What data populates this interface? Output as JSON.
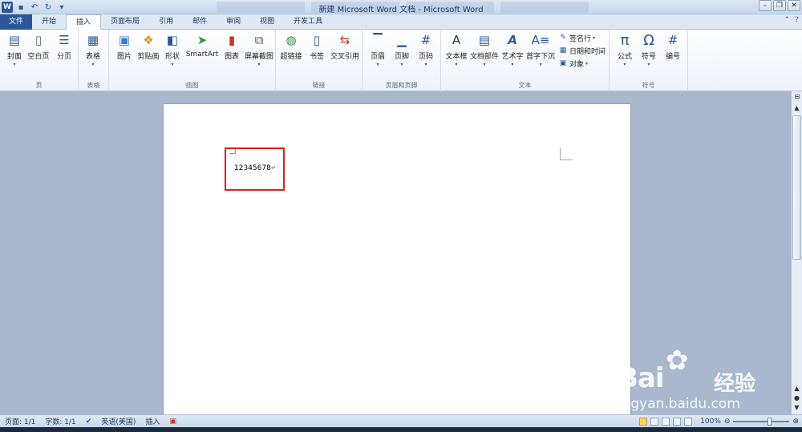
{
  "window": {
    "title": "新建 Microsoft Word 文档 - Microsoft Word",
    "app_logo": "W"
  },
  "tabs": [
    {
      "label": "文件",
      "type": "file"
    },
    {
      "label": "开始"
    },
    {
      "label": "插入",
      "active": true
    },
    {
      "label": "页面布局"
    },
    {
      "label": "引用"
    },
    {
      "label": "邮件"
    },
    {
      "label": "审阅"
    },
    {
      "label": "视图"
    },
    {
      "label": "开发工具"
    }
  ],
  "ribbon": {
    "groups": {
      "pages": {
        "label": "页",
        "buttons": [
          {
            "label": "封面",
            "icon": "cover-page-icon"
          },
          {
            "label": "空白页",
            "icon": "blank-page-icon"
          },
          {
            "label": "分页",
            "icon": "page-break-icon"
          }
        ]
      },
      "tables": {
        "label": "表格",
        "buttons": [
          {
            "label": "表格",
            "icon": "table-icon"
          }
        ]
      },
      "illustrations": {
        "label": "插图",
        "buttons": [
          {
            "label": "图片",
            "icon": "picture-icon"
          },
          {
            "label": "剪贴画",
            "icon": "clipart-icon"
          },
          {
            "label": "形状",
            "icon": "shapes-icon"
          },
          {
            "label": "SmartArt",
            "icon": "smartart-icon"
          },
          {
            "label": "图表",
            "icon": "chart-icon"
          },
          {
            "label": "屏幕截图",
            "icon": "screenshot-icon"
          }
        ]
      },
      "links": {
        "label": "链接",
        "buttons": [
          {
            "label": "超链接",
            "icon": "hyperlink-icon"
          },
          {
            "label": "书签",
            "icon": "bookmark-icon"
          },
          {
            "label": "交叉引用",
            "icon": "cross-reference-icon"
          }
        ]
      },
      "header_footer": {
        "label": "页眉和页脚",
        "buttons": [
          {
            "label": "页眉",
            "icon": "header-icon"
          },
          {
            "label": "页脚",
            "icon": "footer-icon"
          },
          {
            "label": "页码",
            "icon": "page-number-icon"
          }
        ]
      },
      "text": {
        "label": "文本",
        "buttons": [
          {
            "label": "文本框",
            "icon": "textbox-icon"
          },
          {
            "label": "文档部件",
            "icon": "quick-parts-icon"
          },
          {
            "label": "艺术字",
            "icon": "wordart-icon"
          },
          {
            "label": "首字下沉",
            "icon": "drop-cap-icon"
          }
        ],
        "small_buttons": [
          {
            "label": "签名行",
            "icon": "signature-line-icon"
          },
          {
            "label": "日期和时间",
            "icon": "date-time-icon"
          },
          {
            "label": "对象",
            "icon": "object-icon"
          }
        ]
      },
      "symbols": {
        "label": "符号",
        "buttons": [
          {
            "label": "公式",
            "icon": "equation-icon"
          },
          {
            "label": "符号",
            "icon": "symbol-icon"
          },
          {
            "label": "编号",
            "icon": "numbering-icon"
          }
        ]
      }
    }
  },
  "document": {
    "text": "12345678",
    "paragraph_mark": "↵"
  },
  "statusbar": {
    "page": "页面: 1/1",
    "words": "字数: 1/1",
    "language": "英语(美国)",
    "mode": "插入",
    "zoom": "100%",
    "zoom_fraction": 0.63
  },
  "watermark": {
    "brand": "Bai",
    "paw": "du",
    "brand_cn": "经验",
    "url": "jingyan.baidu.com"
  },
  "colors": {
    "file_tab": "#2b579a",
    "highlight": "#e02020"
  }
}
